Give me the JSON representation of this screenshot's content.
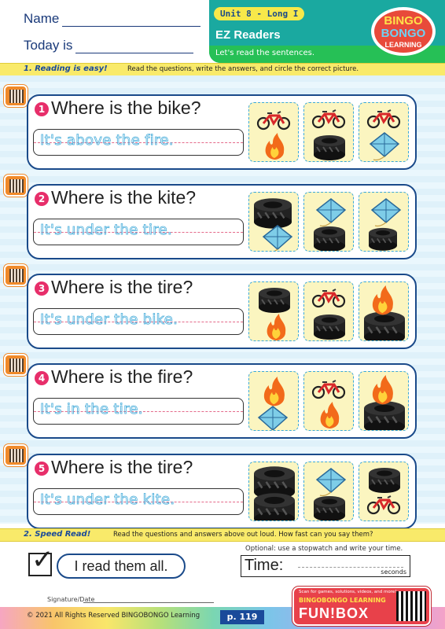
{
  "header": {
    "name_label": "Name",
    "date_label": "Today is",
    "unit": "Unit 8 - Long I",
    "title": "EZ Readers",
    "subtitle": "Let's read the sentences.",
    "logo_lines": [
      "BINGO",
      "BONGO",
      "LEARNING"
    ]
  },
  "section1": {
    "heading": "1. Reading is easy!",
    "instruction": "Read the questions, write the answers, and circle the correct picture."
  },
  "questions": [
    {
      "num": "1",
      "text": "Where is the bike?",
      "answer": "It's above the fire.",
      "pictures": [
        "bike-above-fire",
        "bike-above-tire",
        "bike-above-kite"
      ]
    },
    {
      "num": "2",
      "text": "Where is the kite?",
      "answer": "It's under the tire.",
      "pictures": [
        "tire-above-kite",
        "kite-above-tire",
        "kite-above-tire-2"
      ]
    },
    {
      "num": "3",
      "text": "Where is the tire?",
      "answer": "It's under the bike.",
      "pictures": [
        "tire-above-fire",
        "bike-above-tire",
        "fire-in-tire"
      ]
    },
    {
      "num": "4",
      "text": "Where is the fire?",
      "answer": "It's in the tire.",
      "pictures": [
        "fire-above-kite",
        "bike-above-fire",
        "fire-in-tire"
      ]
    },
    {
      "num": "5",
      "text": "Where is the tire?",
      "answer": "It's under the kite.",
      "pictures": [
        "tire-stack",
        "kite-above-tire",
        "tire-above-bike"
      ]
    }
  ],
  "section2": {
    "heading": "2. Speed Read!",
    "instruction": "Read the questions and answers above out loud. How fast can you say them?",
    "done_label": "I read them all.",
    "optional_note": "Optional: use a stopwatch and write your time.",
    "time_label": "Time:",
    "seconds_label": "seconds"
  },
  "footer": {
    "signature_label": "Signature/Date",
    "copyright": "© 2021 All Rights Reserved BINGOBONGO Learning",
    "page": "p. 119",
    "funbox_note": "Scan for games, solutions, videos, and more!",
    "funbox_brand": "BINGOBONGO LEARNING",
    "funbox_title": "FUN!BOX"
  },
  "colors": {
    "navy": "#1a4a8a",
    "teal": "#1aa9a0",
    "green": "#26c056",
    "yellow": "#f9ea6a",
    "pink": "#e72e6a",
    "orange": "#f08a2a"
  }
}
